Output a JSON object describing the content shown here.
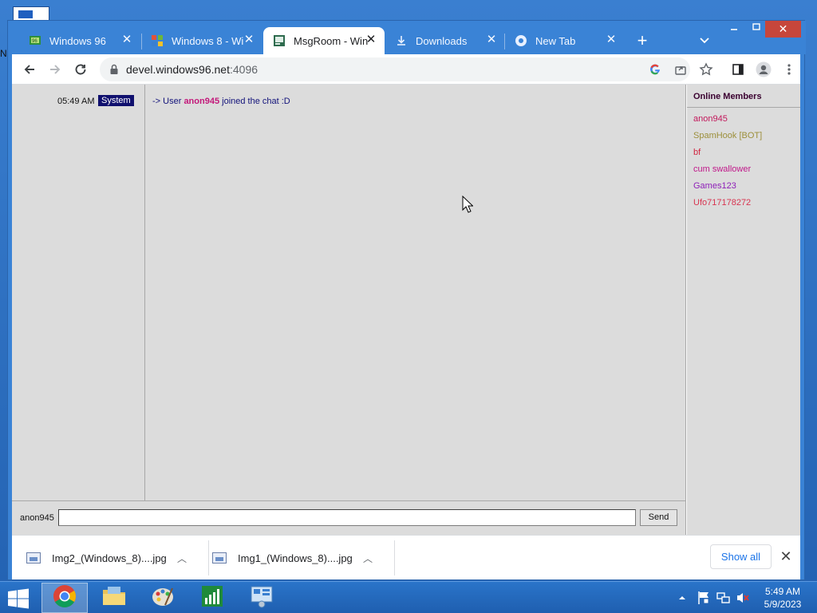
{
  "desktop": {
    "edge_letter": "N"
  },
  "browser": {
    "tabs": [
      {
        "title": "Windows 96",
        "icon": "windows96-icon",
        "active": false
      },
      {
        "title": "Windows 8 - Wi",
        "icon": "windows8-wiki-icon",
        "active": false
      },
      {
        "title": "MsgRoom - Win",
        "icon": "msgroom-icon",
        "active": true
      },
      {
        "title": "Downloads",
        "icon": "download-icon",
        "active": false
      },
      {
        "title": "New Tab",
        "icon": "chrome-icon",
        "active": false
      }
    ],
    "url_host": "devel.windows96.net",
    "url_port": ":4096"
  },
  "chat": {
    "messages": [
      {
        "time": "05:49 AM",
        "sender": "System",
        "text_before": "-> User ",
        "username": "anon945",
        "text_after": " joined the chat :D"
      }
    ],
    "nickname": "anon945",
    "input_value": "",
    "send_label": "Send"
  },
  "members": {
    "title": "Online Members",
    "list": [
      {
        "name": "anon945",
        "color": "#c2185b"
      },
      {
        "name": "SpamHook [BOT]",
        "color": "#9c8f3a"
      },
      {
        "name": "bf",
        "color": "#d0243f"
      },
      {
        "name": "cum swallower",
        "color": "#c0188a"
      },
      {
        "name": "Games123",
        "color": "#8e1fb8"
      },
      {
        "name": "Ufo717178272",
        "color": "#d83450"
      }
    ]
  },
  "downloads": {
    "items": [
      {
        "name": "Img2_(Windows_8)....jpg"
      },
      {
        "name": "Img1_(Windows_8)....jpg"
      }
    ],
    "show_all_label": "Show all"
  },
  "taskbar": {
    "apps": [
      {
        "name": "Google Chrome",
        "icon": "chrome-icon",
        "active": true
      },
      {
        "name": "File Explorer",
        "icon": "folder-icon",
        "active": false
      },
      {
        "name": "Paint",
        "icon": "paint-palette-icon",
        "active": false
      },
      {
        "name": "Task Manager",
        "icon": "chart-icon",
        "active": false
      },
      {
        "name": "Control Panel",
        "icon": "control-panel-icon",
        "active": false
      }
    ],
    "time": "5:49 AM",
    "date": "5/9/2023"
  }
}
